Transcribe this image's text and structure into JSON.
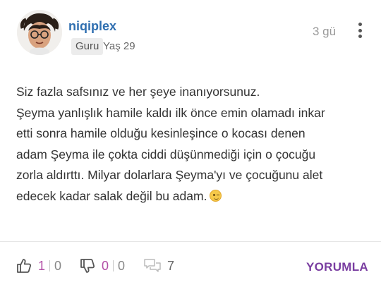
{
  "post": {
    "username": "niqiplex",
    "badge": "Guru",
    "age": "Yaş 29",
    "time": "3 gü",
    "body_lines": [
      "Siz fazla safsınız ve her şeye inanıyorsunuz.",
      "Şeyma yanlışlık hamile kaldı ilk önce emin olamadı inkar",
      "etti sonra hamile olduğu kesinleşince o kocası denen",
      "adam Şeyma ile çokta ciddi düşünmediği için o çocuğu",
      "zorla aldırttı. Milyar dolarlara Şeyma'yı ve çocuğunu alet",
      "edecek kadar salak değil bu adam."
    ],
    "emoji": "wink-emoji"
  },
  "actions": {
    "like_count": "1",
    "like_extra": "0",
    "dislike_count": "0",
    "dislike_extra": "0",
    "comment_count": "7",
    "reply_label": "YORUMLA"
  },
  "colors": {
    "username": "#2f6fb0",
    "accent": "#7a3ea1",
    "like_count": "#b24fa6"
  }
}
